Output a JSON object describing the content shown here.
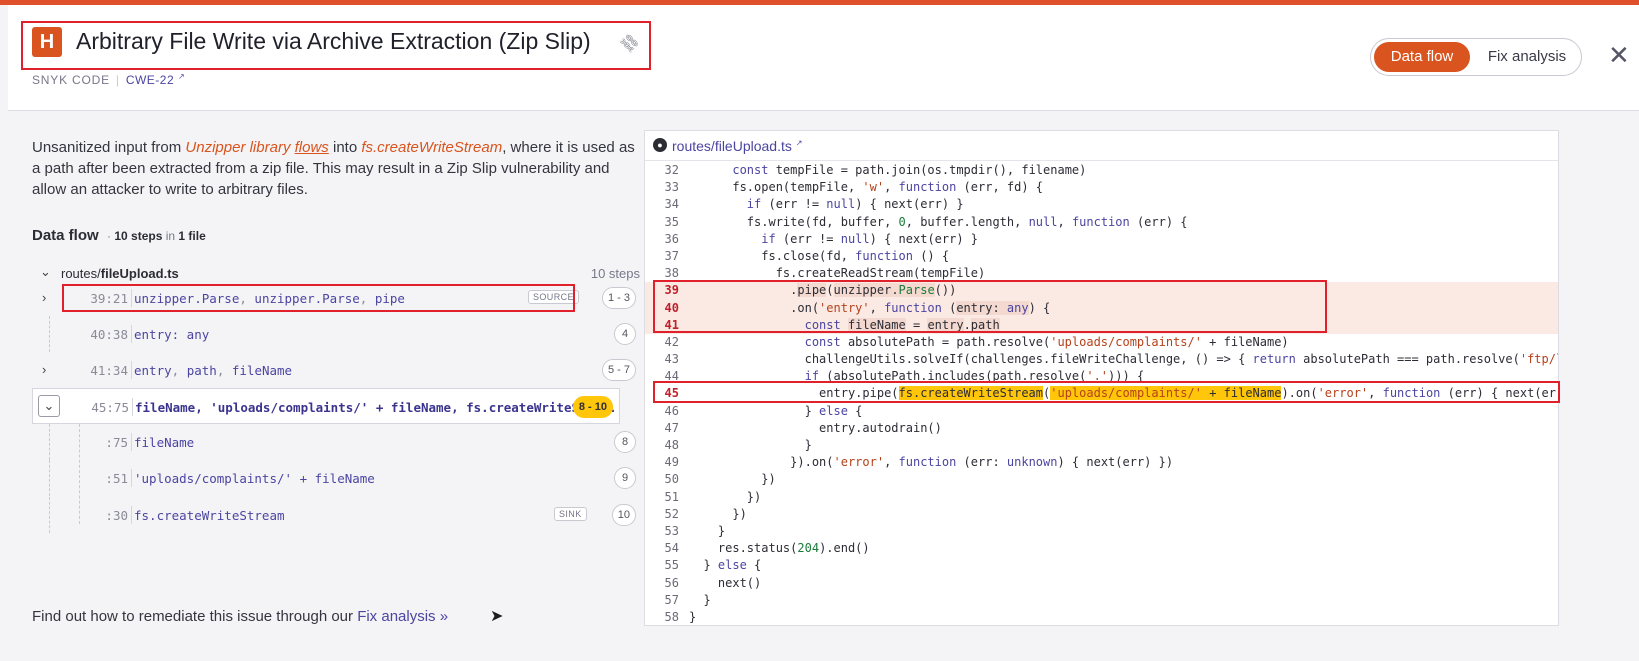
{
  "header": {
    "severity": "H",
    "title": "Arbitrary File Write via Archive Extraction (Zip Slip)",
    "source": "SNYK CODE",
    "cwe": "CWE-22",
    "toggle": {
      "active": "Data flow",
      "inactive": "Fix analysis"
    },
    "close": "✕"
  },
  "description": {
    "pre": "Unsanitized input from ",
    "src1": "Unzipper library",
    "src2": "flows",
    "mid": " into ",
    "sink": "fs.createWriteStream",
    "post": ", where it is used as a path after been extracted from a zip file. This may result in a Zip Slip vulnerability and allow an attacker to write to arbitrary files."
  },
  "dataflow": {
    "title": "Data flow",
    "meta_sep": "·",
    "meta_steps": "10 steps",
    "meta_in": "in",
    "meta_files": "1 file",
    "file_prefix": "routes/",
    "file_name": "fileUpload.ts",
    "file_steps": "10 steps",
    "steps": [
      {
        "loc": "39:21",
        "parts": [
          "unzipper.Parse",
          "unzipper.Parse",
          "pipe"
        ],
        "badge": "SOURCE",
        "num": "1 - 3"
      },
      {
        "loc": "40:38",
        "parts": [
          "entry: any"
        ],
        "badge": "",
        "num": "4"
      },
      {
        "loc": "41:34",
        "parts": [
          "entry",
          "path",
          "fileName"
        ],
        "badge": "",
        "num": "5 - 7"
      },
      {
        "loc": "45:75",
        "text": "fileName, 'uploads/complaints/' + fileName, fs.createWriteStr...",
        "badge": "",
        "num": "8 - 10"
      },
      {
        "loc": ":75",
        "parts": [
          "fileName"
        ],
        "badge": "",
        "num": "8"
      },
      {
        "loc": ":51",
        "parts": [
          "'uploads/complaints/' + fileName"
        ],
        "badge": "",
        "num": "9"
      },
      {
        "loc": ":30",
        "parts": [
          "fs.createWriteStream"
        ],
        "badge": "SINK",
        "num": "10"
      }
    ]
  },
  "remedy": {
    "text": "Find out how to remediate this issue through our ",
    "link": "Fix analysis »"
  },
  "code": {
    "file_prefix": "routes/",
    "file_name": "fileUpload.ts",
    "line_numbers": [
      "32",
      "33",
      "34",
      "35",
      "36",
      "37",
      "38",
      "39",
      "40",
      "41",
      "42",
      "43",
      "44",
      "45",
      "46",
      "47",
      "48",
      "49",
      "50",
      "51",
      "52",
      "53",
      "54",
      "55",
      "56",
      "57",
      "58"
    ]
  }
}
